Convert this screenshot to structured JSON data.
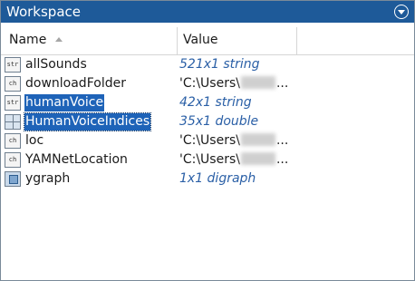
{
  "title": "Workspace",
  "columns": {
    "name": "Name",
    "value": "Value"
  },
  "variables": [
    {
      "name": "allSounds",
      "icon": "string-icon",
      "value": "521x1 string",
      "kind": "size",
      "selected": false
    },
    {
      "name": "downloadFolder",
      "icon": "char-icon",
      "value_prefix": "'C:\\Users\\",
      "value_suffix": "...",
      "kind": "path",
      "selected": false
    },
    {
      "name": "humanVoice",
      "icon": "string-icon",
      "value": "42x1 string",
      "kind": "size",
      "selected": true
    },
    {
      "name": "HumanVoiceIndices",
      "icon": "double-array-icon",
      "value": "35x1 double",
      "kind": "size",
      "selected": true
    },
    {
      "name": "loc",
      "icon": "char-icon",
      "value_prefix": "'C:\\Users\\",
      "value_suffix": "...",
      "kind": "path",
      "selected": false
    },
    {
      "name": "YAMNetLocation",
      "icon": "char-icon",
      "value_prefix": "'C:\\Users\\",
      "value_suffix": "...",
      "kind": "path",
      "selected": false
    },
    {
      "name": "ygraph",
      "icon": "graph-object-icon",
      "value": "1x1 digraph",
      "kind": "size",
      "selected": false
    }
  ],
  "colors": {
    "titlebar": "#1e5a99",
    "selection": "#1e63b8",
    "size_text": "#2a5fa6"
  }
}
